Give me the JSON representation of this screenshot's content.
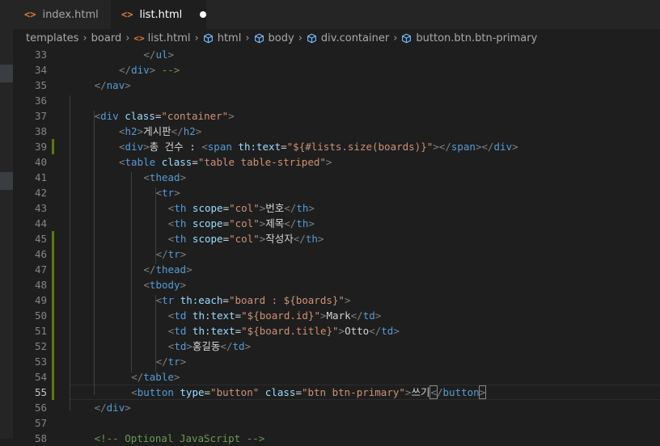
{
  "tabs": [
    {
      "label": "index.html",
      "icon": "html-file-icon",
      "active": false
    },
    {
      "label": "list.html",
      "icon": "html-file-icon",
      "active": true,
      "modified": true
    }
  ],
  "breadcrumb": [
    "templates",
    "board",
    "list.html",
    "html",
    "body",
    "div.container",
    "button.btn.btn-primary"
  ],
  "lines": [
    {
      "n": "33",
      "indent": 14,
      "tokens": [
        {
          "c": "p",
          "t": "</"
        },
        {
          "c": "t",
          "t": "ul"
        },
        {
          "c": "p",
          "t": ">"
        }
      ]
    },
    {
      "n": "34",
      "indent": 10,
      "tokens": [
        {
          "c": "p",
          "t": "</"
        },
        {
          "c": "t",
          "t": "div"
        },
        {
          "c": "p",
          "t": ">"
        },
        {
          "c": "c",
          "t": " -->"
        }
      ]
    },
    {
      "n": "35",
      "indent": 6,
      "tokens": [
        {
          "c": "p",
          "t": "</"
        },
        {
          "c": "t",
          "t": "nav"
        },
        {
          "c": "p",
          "t": ">"
        }
      ]
    },
    {
      "n": "36",
      "indent": 0,
      "tokens": []
    },
    {
      "n": "37",
      "indent": 6,
      "tokens": [
        {
          "c": "p",
          "t": "<"
        },
        {
          "c": "t",
          "t": "div"
        },
        {
          "c": "x",
          "t": " "
        },
        {
          "c": "a",
          "t": "class"
        },
        {
          "c": "x",
          "t": "="
        },
        {
          "c": "s",
          "t": "\"container\""
        },
        {
          "c": "p",
          "t": ">"
        }
      ]
    },
    {
      "n": "38",
      "indent": 10,
      "tokens": [
        {
          "c": "p",
          "t": "<"
        },
        {
          "c": "t",
          "t": "h2"
        },
        {
          "c": "p",
          "t": ">"
        },
        {
          "c": "x",
          "t": "게시판"
        },
        {
          "c": "p",
          "t": "</"
        },
        {
          "c": "t",
          "t": "h2"
        },
        {
          "c": "p",
          "t": ">"
        }
      ]
    },
    {
      "n": "39",
      "indent": 10,
      "tokens": [
        {
          "c": "p",
          "t": "<"
        },
        {
          "c": "t",
          "t": "div"
        },
        {
          "c": "p",
          "t": ">"
        },
        {
          "c": "x",
          "t": "총 건수 : "
        },
        {
          "c": "p",
          "t": "<"
        },
        {
          "c": "t",
          "t": "span"
        },
        {
          "c": "x",
          "t": " "
        },
        {
          "c": "a",
          "t": "th:text"
        },
        {
          "c": "x",
          "t": "="
        },
        {
          "c": "s",
          "t": "\"${#lists.size(boards)}\""
        },
        {
          "c": "p",
          "t": "></"
        },
        {
          "c": "t",
          "t": "span"
        },
        {
          "c": "p",
          "t": "></"
        },
        {
          "c": "t",
          "t": "div"
        },
        {
          "c": "p",
          "t": ">"
        }
      ]
    },
    {
      "n": "40",
      "indent": 10,
      "tokens": [
        {
          "c": "p",
          "t": "<"
        },
        {
          "c": "t",
          "t": "table"
        },
        {
          "c": "x",
          "t": " "
        },
        {
          "c": "a",
          "t": "class"
        },
        {
          "c": "x",
          "t": "="
        },
        {
          "c": "s",
          "t": "\"table table-striped\""
        },
        {
          "c": "p",
          "t": ">"
        }
      ]
    },
    {
      "n": "41",
      "indent": 14,
      "tokens": [
        {
          "c": "p",
          "t": "<"
        },
        {
          "c": "t",
          "t": "thead"
        },
        {
          "c": "p",
          "t": ">"
        }
      ]
    },
    {
      "n": "42",
      "indent": 16,
      "tokens": [
        {
          "c": "p",
          "t": "<"
        },
        {
          "c": "t",
          "t": "tr"
        },
        {
          "c": "p",
          "t": ">"
        }
      ]
    },
    {
      "n": "43",
      "indent": 18,
      "tokens": [
        {
          "c": "p",
          "t": "<"
        },
        {
          "c": "t",
          "t": "th"
        },
        {
          "c": "x",
          "t": " "
        },
        {
          "c": "a",
          "t": "scope"
        },
        {
          "c": "x",
          "t": "="
        },
        {
          "c": "s",
          "t": "\"col\""
        },
        {
          "c": "p",
          "t": ">"
        },
        {
          "c": "x",
          "t": "번호"
        },
        {
          "c": "p",
          "t": "</"
        },
        {
          "c": "t",
          "t": "th"
        },
        {
          "c": "p",
          "t": ">"
        }
      ]
    },
    {
      "n": "44",
      "indent": 18,
      "tokens": [
        {
          "c": "p",
          "t": "<"
        },
        {
          "c": "t",
          "t": "th"
        },
        {
          "c": "x",
          "t": " "
        },
        {
          "c": "a",
          "t": "scope"
        },
        {
          "c": "x",
          "t": "="
        },
        {
          "c": "s",
          "t": "\"col\""
        },
        {
          "c": "p",
          "t": ">"
        },
        {
          "c": "x",
          "t": "제목"
        },
        {
          "c": "p",
          "t": "</"
        },
        {
          "c": "t",
          "t": "th"
        },
        {
          "c": "p",
          "t": ">"
        }
      ]
    },
    {
      "n": "45",
      "indent": 18,
      "tokens": [
        {
          "c": "p",
          "t": "<"
        },
        {
          "c": "t",
          "t": "th"
        },
        {
          "c": "x",
          "t": " "
        },
        {
          "c": "a",
          "t": "scope"
        },
        {
          "c": "x",
          "t": "="
        },
        {
          "c": "s",
          "t": "\"col\""
        },
        {
          "c": "p",
          "t": ">"
        },
        {
          "c": "x",
          "t": "작성자"
        },
        {
          "c": "p",
          "t": "</"
        },
        {
          "c": "t",
          "t": "th"
        },
        {
          "c": "p",
          "t": ">"
        }
      ]
    },
    {
      "n": "46",
      "indent": 16,
      "tokens": [
        {
          "c": "p",
          "t": "</"
        },
        {
          "c": "t",
          "t": "tr"
        },
        {
          "c": "p",
          "t": ">"
        }
      ]
    },
    {
      "n": "47",
      "indent": 14,
      "tokens": [
        {
          "c": "p",
          "t": "</"
        },
        {
          "c": "t",
          "t": "thead"
        },
        {
          "c": "p",
          "t": ">"
        }
      ]
    },
    {
      "n": "48",
      "indent": 14,
      "tokens": [
        {
          "c": "p",
          "t": "<"
        },
        {
          "c": "t",
          "t": "tbody"
        },
        {
          "c": "p",
          "t": ">"
        }
      ]
    },
    {
      "n": "49",
      "indent": 16,
      "tokens": [
        {
          "c": "p",
          "t": "<"
        },
        {
          "c": "t",
          "t": "tr"
        },
        {
          "c": "x",
          "t": " "
        },
        {
          "c": "a",
          "t": "th:each"
        },
        {
          "c": "x",
          "t": "="
        },
        {
          "c": "s",
          "t": "\"board : ${boards}\""
        },
        {
          "c": "p",
          "t": ">"
        }
      ]
    },
    {
      "n": "50",
      "indent": 18,
      "tokens": [
        {
          "c": "p",
          "t": "<"
        },
        {
          "c": "t",
          "t": "td"
        },
        {
          "c": "x",
          "t": " "
        },
        {
          "c": "a",
          "t": "th:text"
        },
        {
          "c": "x",
          "t": "="
        },
        {
          "c": "s",
          "t": "\"${board.id}\""
        },
        {
          "c": "p",
          "t": ">"
        },
        {
          "c": "x",
          "t": "Mark"
        },
        {
          "c": "p",
          "t": "</"
        },
        {
          "c": "t",
          "t": "td"
        },
        {
          "c": "p",
          "t": ">"
        }
      ]
    },
    {
      "n": "51",
      "indent": 18,
      "tokens": [
        {
          "c": "p",
          "t": "<"
        },
        {
          "c": "t",
          "t": "td"
        },
        {
          "c": "x",
          "t": " "
        },
        {
          "c": "a",
          "t": "th:text"
        },
        {
          "c": "x",
          "t": "="
        },
        {
          "c": "s",
          "t": "\"${board.title}\""
        },
        {
          "c": "p",
          "t": ">"
        },
        {
          "c": "x",
          "t": "Otto"
        },
        {
          "c": "p",
          "t": "</"
        },
        {
          "c": "t",
          "t": "td"
        },
        {
          "c": "p",
          "t": ">"
        }
      ]
    },
    {
      "n": "52",
      "indent": 18,
      "tokens": [
        {
          "c": "p",
          "t": "<"
        },
        {
          "c": "t",
          "t": "td"
        },
        {
          "c": "p",
          "t": ">"
        },
        {
          "c": "x",
          "t": "홍길동"
        },
        {
          "c": "p",
          "t": "</"
        },
        {
          "c": "t",
          "t": "td"
        },
        {
          "c": "p",
          "t": ">"
        }
      ]
    },
    {
      "n": "53",
      "indent": 16,
      "tokens": [
        {
          "c": "p",
          "t": "</"
        },
        {
          "c": "t",
          "t": "tr"
        },
        {
          "c": "p",
          "t": ">"
        }
      ]
    },
    {
      "n": "54",
      "indent": 12,
      "tokens": [
        {
          "c": "p",
          "t": "</"
        },
        {
          "c": "t",
          "t": "table"
        },
        {
          "c": "p",
          "t": ">"
        }
      ]
    },
    {
      "n": "55",
      "indent": 12,
      "current": true,
      "tokens": [
        {
          "c": "p",
          "t": "<"
        },
        {
          "c": "t",
          "t": "button"
        },
        {
          "c": "x",
          "t": " "
        },
        {
          "c": "a",
          "t": "type"
        },
        {
          "c": "x",
          "t": "="
        },
        {
          "c": "s",
          "t": "\"button\""
        },
        {
          "c": "x",
          "t": " "
        },
        {
          "c": "a",
          "t": "class"
        },
        {
          "c": "x",
          "t": "="
        },
        {
          "c": "s",
          "t": "\"btn btn-primary\""
        },
        {
          "c": "p",
          "t": ">"
        },
        {
          "c": "x",
          "t": "쓰기"
        },
        {
          "c": "caret",
          "t": ""
        },
        {
          "c": "pb",
          "t": "<"
        },
        {
          "c": "p",
          "t": "/"
        },
        {
          "c": "t",
          "t": "button"
        },
        {
          "c": "pb",
          "t": ">"
        }
      ]
    },
    {
      "n": "56",
      "indent": 6,
      "tokens": [
        {
          "c": "p",
          "t": "</"
        },
        {
          "c": "t",
          "t": "div"
        },
        {
          "c": "p",
          "t": ">"
        }
      ]
    },
    {
      "n": "57",
      "indent": 0,
      "tokens": []
    },
    {
      "n": "58",
      "indent": 6,
      "tokens": [
        {
          "c": "c",
          "t": "<!-- Optional JavaScript -->"
        }
      ]
    }
  ]
}
